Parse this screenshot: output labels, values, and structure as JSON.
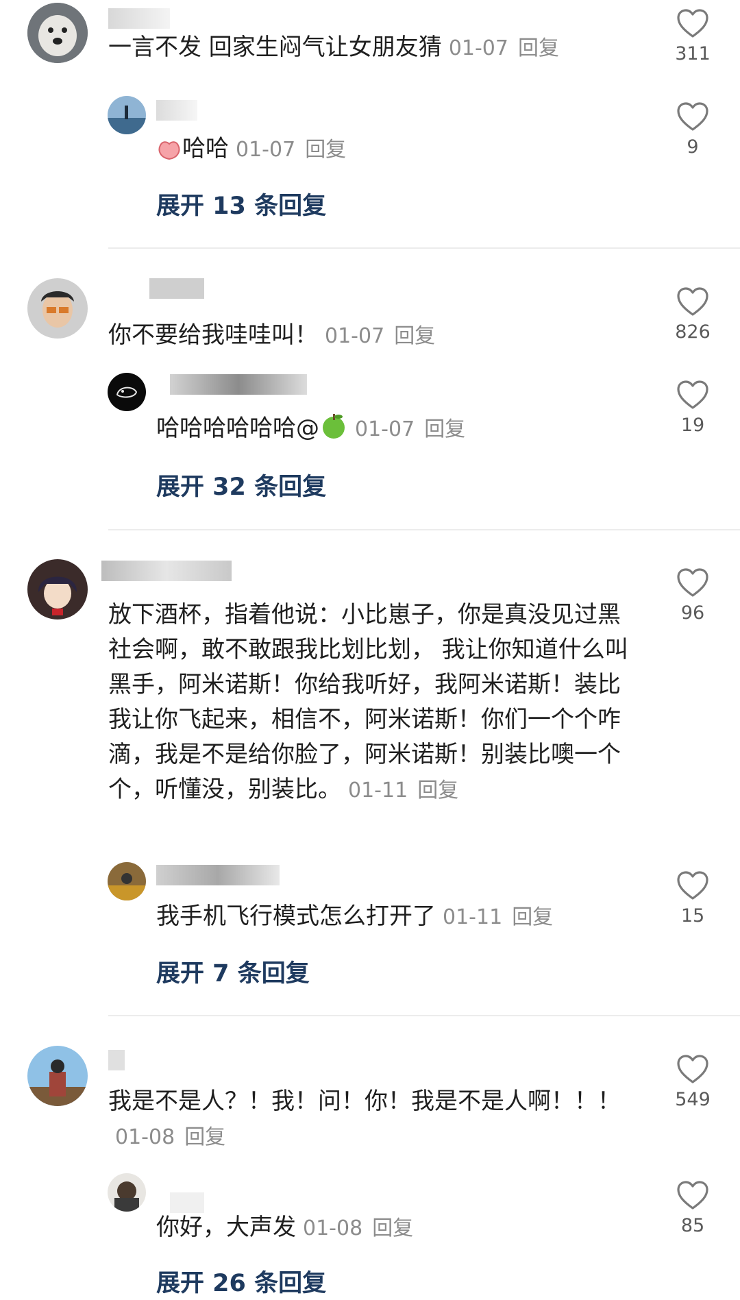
{
  "threads": [
    {
      "text": "一言不发 回家生闷气让女朋友猜",
      "date": "01-07",
      "reply_label": "回复",
      "likes": "311",
      "sub": {
        "text": "哈哈",
        "date": "01-07",
        "reply_label": "回复",
        "likes": "9"
      },
      "expand_label": "展开 13 条回复"
    },
    {
      "text": "你不要给我哇哇叫！",
      "date": "01-07",
      "reply_label": "回复",
      "likes": "826",
      "sub": {
        "text": "哈哈哈哈哈哈@",
        "date": "01-07",
        "reply_label": "回复",
        "likes": "19"
      },
      "expand_label": "展开 32 条回复"
    },
    {
      "text": "放下酒杯，指着他说：小比崽子，你是真没见过黑社会啊，敢不敢跟我比划比划， 我让你知道什么叫黑手，阿米诺斯！你给我听好，我阿米诺斯！装比我让你飞起来，相信不，阿米诺斯！你们一个个咋滴，我是不是给你脸了，阿米诺斯！别装比噢一个个，听懂没，别装比。",
      "date": "01-11",
      "reply_label": "回复",
      "likes": "96",
      "sub": {
        "text": "我手机飞行模式怎么打开了",
        "date": "01-11",
        "reply_label": "回复",
        "likes": "15"
      },
      "expand_label": "展开 7 条回复"
    },
    {
      "text": "我是不是人？！我！问！你！我是不是人啊！！！",
      "date": "01-08",
      "reply_label": "回复",
      "likes": "549",
      "sub": {
        "text": "你好，大声发",
        "date": "01-08",
        "reply_label": "回复",
        "likes": "85"
      },
      "expand_label": "展开 26 条回复"
    }
  ],
  "colors": {
    "accent": "#1e3a5f",
    "meta": "#8c8c8c",
    "divider": "#ececec"
  },
  "icons": {
    "like": "heart-outline-icon",
    "sub1_emoji": "peach-emoji-icon",
    "sub2_emoji": "green-apple-emoji-icon"
  }
}
